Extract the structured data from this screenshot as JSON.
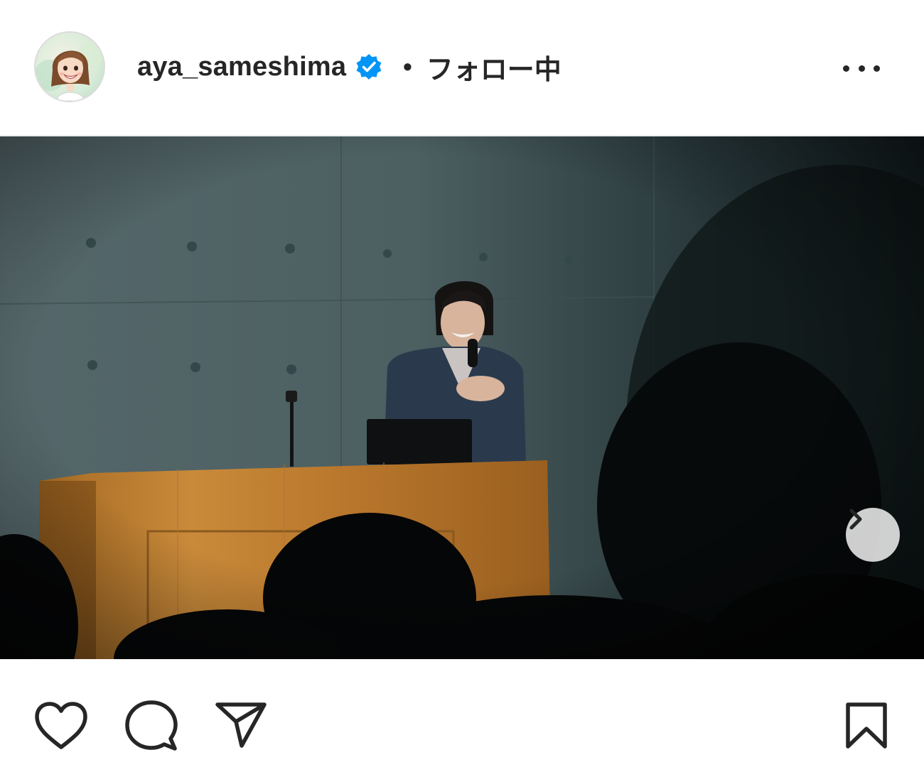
{
  "header": {
    "username": "aya_sameshima",
    "separator": "•",
    "follow_status": "フォロー中",
    "avatar_icon": "profile-avatar-illustration",
    "verified_icon": "verified-badge-icon",
    "more_icon": "more-options-icon"
  },
  "media": {
    "type": "video-carousel",
    "carousel": {
      "count": 3,
      "active_index": 0
    },
    "next_icon": "chevron-right-icon",
    "mute_icon": "volume-muted-icon"
  },
  "actions": {
    "like_icon": "heart-icon",
    "comment_icon": "comment-icon",
    "share_icon": "paper-plane-icon",
    "save_icon": "bookmark-icon"
  },
  "colors": {
    "text": "#262626",
    "verified": "#0095f6",
    "background": "#ffffff"
  }
}
